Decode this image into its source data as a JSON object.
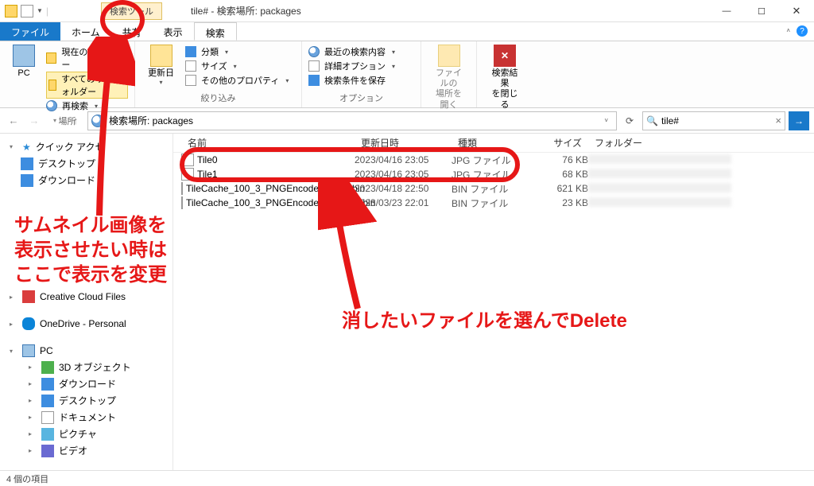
{
  "titlebar": {
    "context_tab": "検索ツール",
    "title": "tile# - 検索場所: packages",
    "min": "—",
    "max": "☐",
    "close": "✕"
  },
  "tabs": {
    "file": "ファイル",
    "home": "ホーム",
    "share": "共有",
    "view": "表示",
    "search": "検索"
  },
  "ribbon": {
    "group1": {
      "pc": "PC",
      "current_folder": "現在のフォルダー",
      "all_subfolders": "すべてのサブフォルダー",
      "search_again": "再検索",
      "label": "場所"
    },
    "group2": {
      "update_date": "更新日",
      "kind": "分類",
      "size": "サイズ",
      "other_prop": "その他のプロパティ",
      "label": "絞り込み"
    },
    "group3": {
      "recent": "最近の検索内容",
      "adv_options": "詳細オプション",
      "save_cond": "検索条件を保存",
      "label": "オプション"
    },
    "group4": {
      "open_loc_1": "ファイルの",
      "open_loc_2": "場所を開く"
    },
    "group5": {
      "close_1": "検索結果",
      "close_2": "を閉じる"
    }
  },
  "addr": {
    "text": "検索場所: packages"
  },
  "search": {
    "value": "tile#"
  },
  "sidebar": {
    "quick": "クイック アクセ",
    "desktop": "デスクトップ",
    "downloads": "ダウンロード",
    "ccf": "Creative Cloud Files",
    "onedrive": "OneDrive - Personal",
    "pc": "PC",
    "pc_items": {
      "obj3d": "3D オブジェクト",
      "downloads": "ダウンロード",
      "desktop": "デスクトップ",
      "documents": "ドキュメント",
      "pictures": "ピクチャ",
      "videos": "ビデオ"
    }
  },
  "columns": {
    "name": "名前",
    "date": "更新日時",
    "type": "種類",
    "size": "サイズ",
    "folder": "フォルダー"
  },
  "files": [
    {
      "name": "Tile0",
      "date": "2023/04/16 23:05",
      "type": "JPG ファイル",
      "size": "76 KB"
    },
    {
      "name": "Tile1",
      "date": "2023/04/16 23:05",
      "type": "JPG ファイル",
      "size": "68 KB"
    },
    {
      "name": "TileCache_100_3_PNGEncoded_Data.bin",
      "date": "2023/04/18 22:50",
      "type": "BIN ファイル",
      "size": "621 KB"
    },
    {
      "name": "TileCache_100_3_PNGEncoded_Header.bin",
      "date": "2023/03/23 22:01",
      "type": "BIN ファイル",
      "size": "23 KB"
    }
  ],
  "status": "4 個の項目",
  "annot": {
    "t1": "サムネイル画像を\n表示させたい時は\nここで表示を変更",
    "t2": "消したいファイルを選んでDelete"
  }
}
